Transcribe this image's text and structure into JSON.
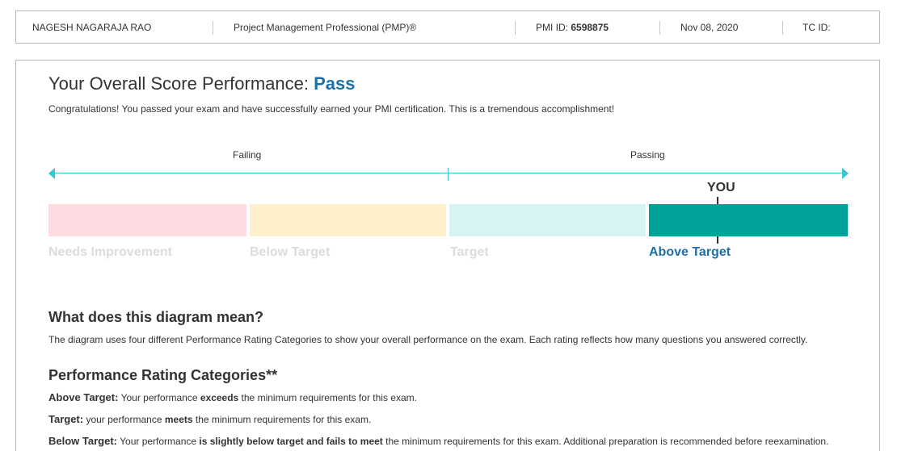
{
  "header": {
    "candidate_name": "NAGESH NAGARAJA RAO",
    "certification": "Project Management Professional (PMP)®",
    "pmi_id_label": "PMI ID:",
    "pmi_id_value": "6598875",
    "date": "Nov 08, 2020",
    "tc_id_label": "TC ID:"
  },
  "score": {
    "title_prefix": "Your Overall Score Performance:",
    "result": "Pass",
    "congrats": "Congratulations! You passed your exam and have successfully earned your PMI certification. This is a tremendous accomplishment!",
    "scale_failing": "Failing",
    "scale_passing": "Passing",
    "you_label": "YOU",
    "bands": [
      {
        "label": "Needs Improvement",
        "color": "#fddbe0",
        "label_color": "#dcdcdc"
      },
      {
        "label": "Below Target",
        "color": "#fff0cc",
        "label_color": "#dcdcdc"
      },
      {
        "label": "Target",
        "color": "#d6f4f2",
        "label_color": "#dcdcdc"
      },
      {
        "label": "Above Target",
        "color": "#00a39b",
        "label_color": "#1f6fa9"
      }
    ],
    "achieved_band_index": 3,
    "accent_color": "#3bc3d6"
  },
  "diagram_meaning": {
    "heading": "What does this diagram mean?",
    "text": "The diagram uses four different Performance Rating Categories to show your overall performance on the exam. Each rating reflects how many questions you answered correctly."
  },
  "categories": {
    "heading": "Performance Rating Categories**",
    "items": [
      {
        "name": "Above Target:",
        "pre": "Your performance ",
        "bold": "exceeds",
        "post": " the minimum requirements for this exam."
      },
      {
        "name": "Target:",
        "pre": "your performance ",
        "bold": "meets",
        "post": " the minimum requirements for this exam."
      },
      {
        "name": "Below Target:",
        "pre": "Your performance ",
        "bold": "is slightly below target and fails to meet",
        "post": " the minimum requirements for this exam. Additional preparation is recommended before reexamination."
      }
    ]
  }
}
